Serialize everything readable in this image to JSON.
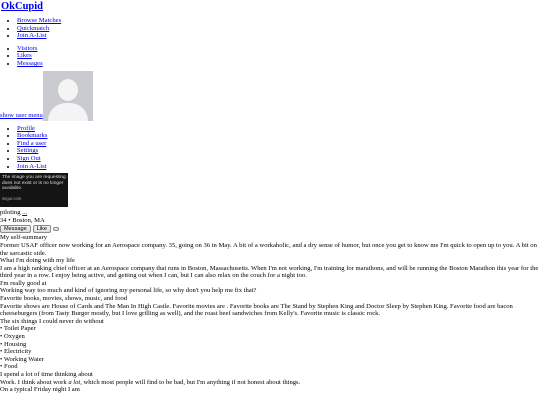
{
  "site": {
    "logo": "OkCupid"
  },
  "nav_primary": [
    "Browse Matches",
    "Quickmatch",
    "Join A-List"
  ],
  "nav_secondary": [
    "Visitors",
    "Likes",
    "Messages"
  ],
  "user_menu": {
    "toggle": "show user menu",
    "items": [
      "Profile",
      "Bookmarks",
      "Find a user",
      "Settings",
      "Sign Out",
      "Join A-List"
    ]
  },
  "missing_image": {
    "text": "The image you are requesting does not exist or is no longer available.",
    "brand": "imgur.com"
  },
  "profile": {
    "username": "piloting",
    "username_more": "...",
    "details": "34 • Boston, MA",
    "buttons": {
      "message": "Message",
      "like": "Like",
      "more": ""
    }
  },
  "essays": [
    {
      "heading": "My self-summary",
      "body": "Former USAF officer now working for an Aerospace company. 35, going on 36 in May. A bit of a workaholic, and a dry sense of humor, but once you get to know me I'm quick to open up to you. A bit on the sarcastic side."
    },
    {
      "heading": "What I'm doing with my life",
      "body": "I am a high ranking chief officer at an Aerospace company that runs in Boston, Massachusetts. When I'm not working, I'm training for marathons, and will be running the Boston Marathon this year for the third year in a row. I enjoy being active, and getting out when I can, but I can also relax on the couch for a night too."
    },
    {
      "heading": "I'm really good at",
      "body": "Working way too much and kind of ignoring my personal life, so why don't you help me fix that?"
    },
    {
      "heading": "Favorite books, movies, shows, music, and food",
      "body": "Favorite shows are House of Cards and The Man In High Castle. Favorite movies are . Favorite books are The Stand by Stephen King and Doctor Sleep by Stephen King. Favorite food are bacon cheeseburgers (from Tasty Burger mostly, but I love grilling as well), and the roast beef sandwiches from Kelly's. Favorite music is classic rock."
    }
  ],
  "six_things": {
    "heading": "The six things I could never do without",
    "items": [
      "Toilet Paper",
      "Oxygen",
      "Housing",
      "Electricity",
      "Working Water",
      "Food"
    ]
  },
  "thinking": {
    "heading": "I spend a lot of time thinking about",
    "body_pre": "Work. I think about work ",
    "body_em": "a lot",
    "body_post": ", which most people will find to be bad, but I'm anything if not honest about things."
  },
  "friday": {
    "heading": "On a typical Friday night I am"
  }
}
